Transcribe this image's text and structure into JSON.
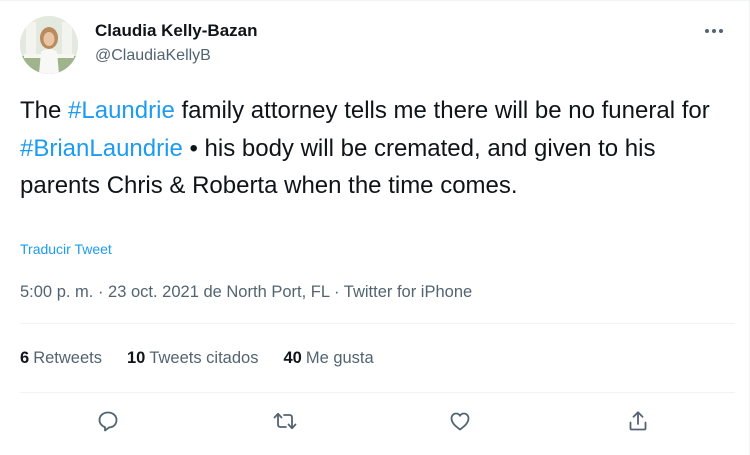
{
  "author": {
    "name": "Claudia Kelly-Bazan",
    "handle": "@ClaudiaKellyB"
  },
  "tweet": {
    "segments": [
      {
        "text": "The ",
        "hashtag": false
      },
      {
        "text": "#Laundrie",
        "hashtag": true
      },
      {
        "text": " family attorney tells me there will be no funeral for ",
        "hashtag": false
      },
      {
        "text": "#BrianLaundrie",
        "hashtag": true
      },
      {
        "text": " • his body will be cremated, and given to his parents Chris & Roberta when the time comes.",
        "hashtag": false
      }
    ],
    "translate_label": "Traducir Tweet"
  },
  "meta": {
    "time": "5:00 p. m.",
    "sep1": " · ",
    "date": "23 oct. 2021",
    "location": " de North Port, FL",
    "sep2": " · ",
    "source": "Twitter for iPhone"
  },
  "stats": {
    "retweets": {
      "count": "6",
      "label": "Retweets"
    },
    "quotes": {
      "count": "10",
      "label": "Tweets citados"
    },
    "likes": {
      "count": "40",
      "label": "Me gusta"
    }
  },
  "icons": {
    "more": "more-icon",
    "reply": "reply-icon",
    "retweet": "retweet-icon",
    "like": "like-icon",
    "share": "share-icon"
  },
  "colors": {
    "accent": "#1d9bf0",
    "text": "#0f1419",
    "secondary": "#536471",
    "divider": "#eff3f4"
  }
}
